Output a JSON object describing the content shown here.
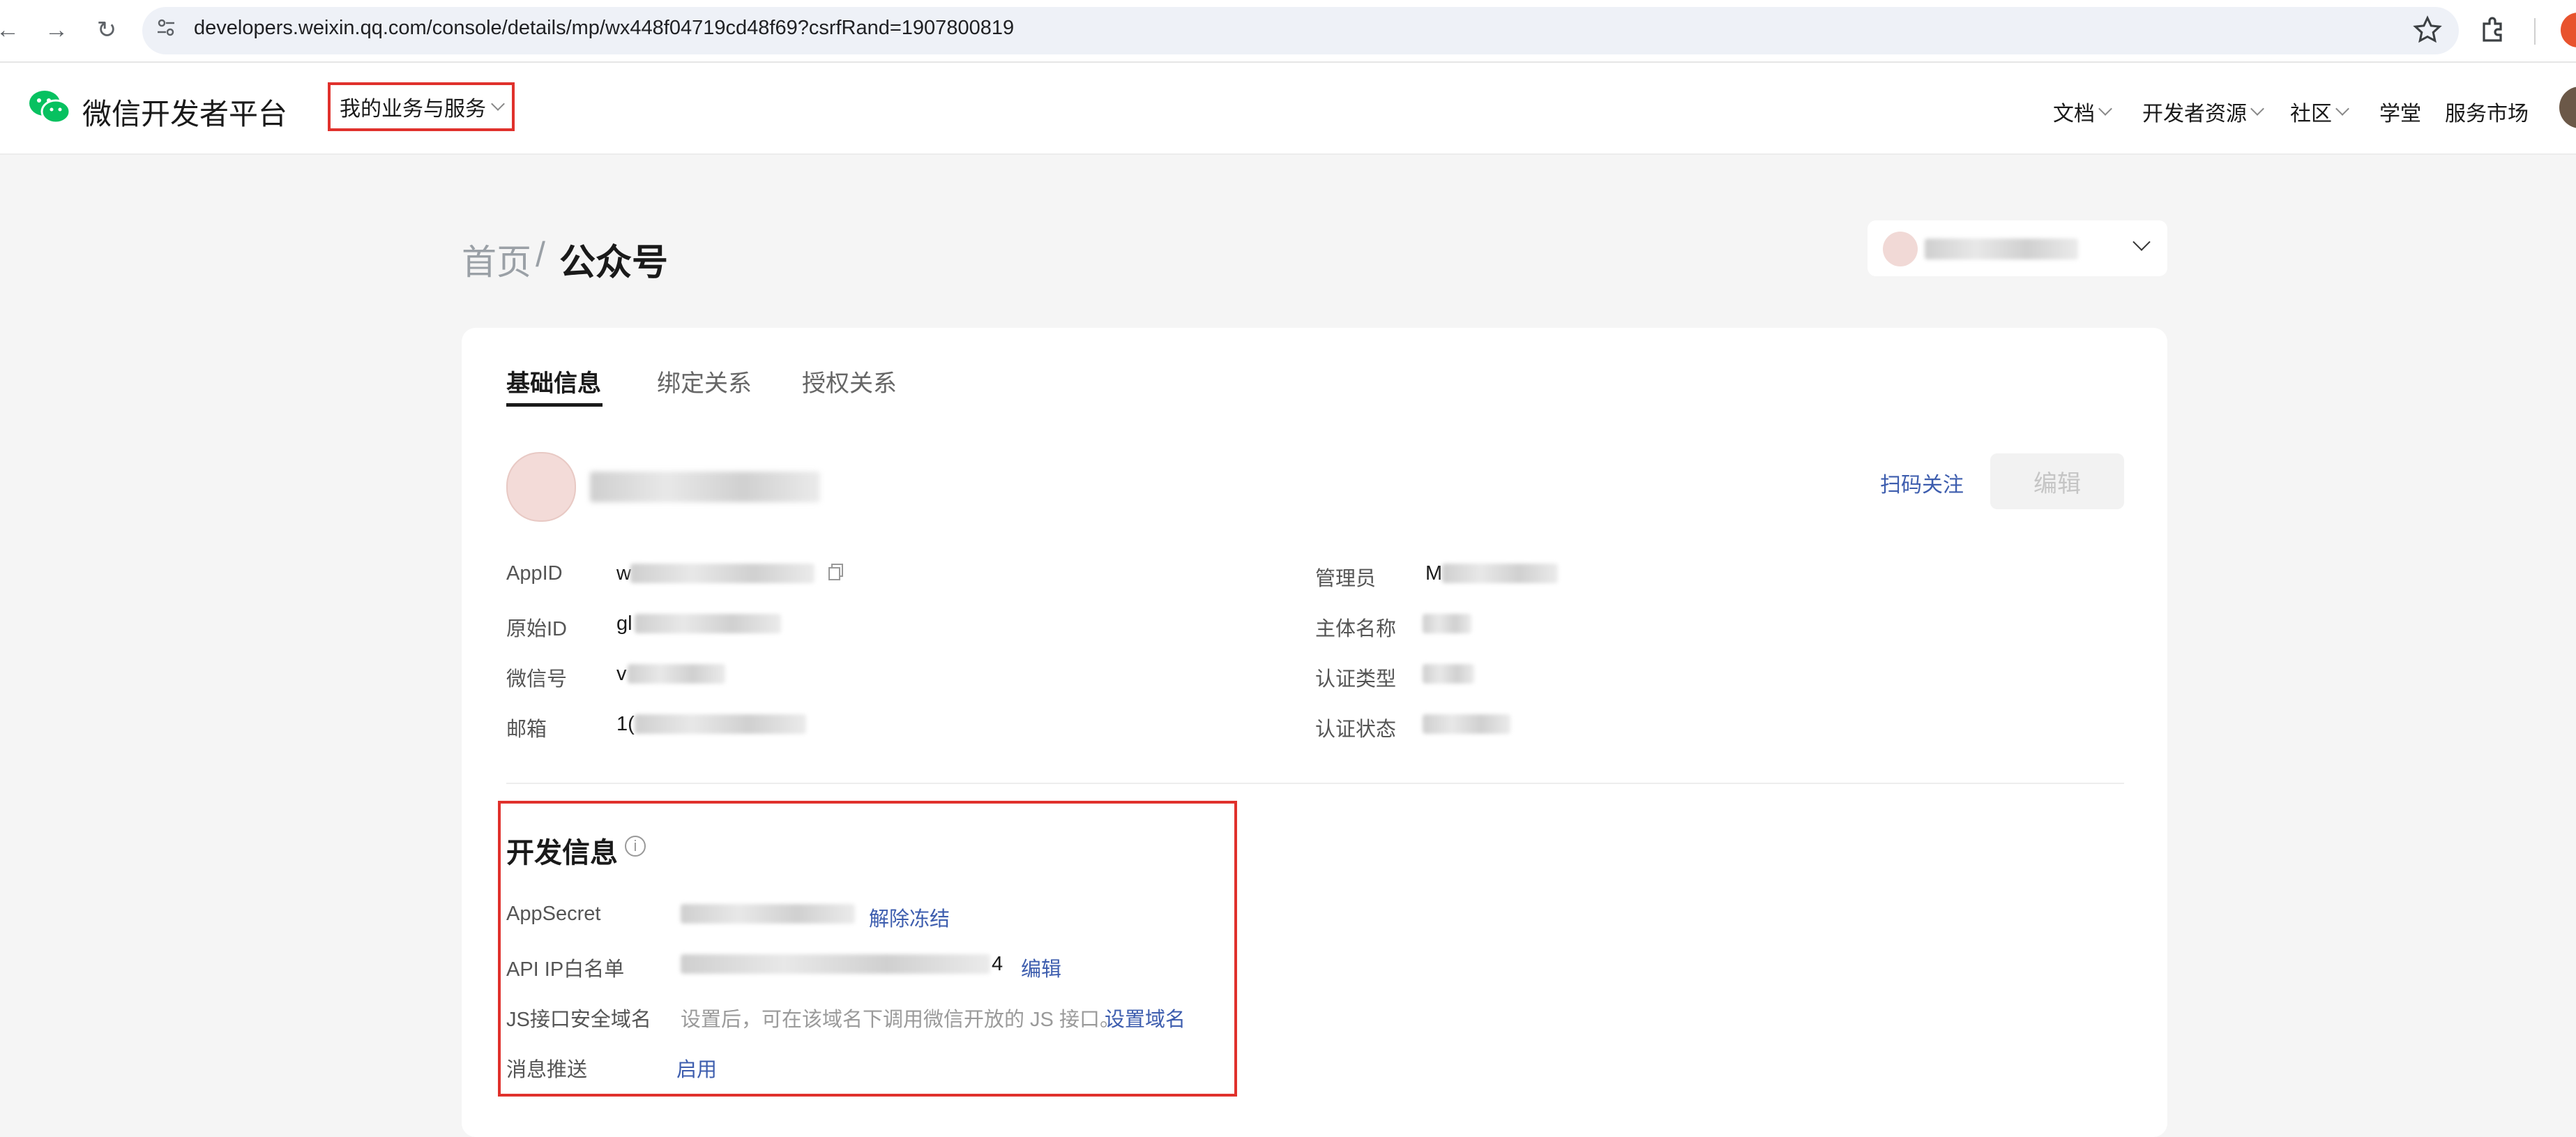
{
  "browser": {
    "url": "developers.weixin.qq.com/console/details/mp/wx448f04719cd48f69?csrfRand=1907800819",
    "icons": [
      "back-icon",
      "forward-icon",
      "reload-icon",
      "site-info-icon",
      "star-icon",
      "extensions-icon"
    ]
  },
  "topnav": {
    "brand": "微信开发者平台",
    "biz_menu": "我的业务与服务",
    "links": [
      "文档",
      "开发者资源",
      "社区",
      "学堂",
      "服务市场"
    ]
  },
  "breadcrumb": {
    "home": "首页",
    "separator": "/",
    "current": "公众号"
  },
  "tabs": [
    "基础信息",
    "绑定关系",
    "授权关系"
  ],
  "profile": {
    "scan_follow": "扫码关注",
    "edit": "编辑"
  },
  "basic_info": {
    "left_labels": [
      "AppID",
      "原始ID",
      "微信号",
      "邮箱"
    ],
    "left_value_prefixes": [
      "w",
      "gl",
      "v",
      "1("
    ],
    "right_labels": [
      "管理员",
      "主体名称",
      "认证类型",
      "认证状态"
    ],
    "right_value_prefixes": [
      "M",
      "",
      "",
      " "
    ]
  },
  "dev_info": {
    "title": "开发信息",
    "rows": [
      {
        "label": "AppSecret",
        "action": "解除冻结"
      },
      {
        "label": "API IP白名单",
        "suffix": "4",
        "action": "编辑"
      },
      {
        "label": "JS接口安全域名",
        "hint": "设置后，可在该域名下调用微信开放的 JS 接口。",
        "action": "设置域名"
      },
      {
        "label": "消息推送",
        "action": "启用"
      }
    ]
  },
  "colors": {
    "accent_link": "#3d5dae",
    "highlight_box": "#e0312c",
    "wechat_green": "#07c160"
  }
}
